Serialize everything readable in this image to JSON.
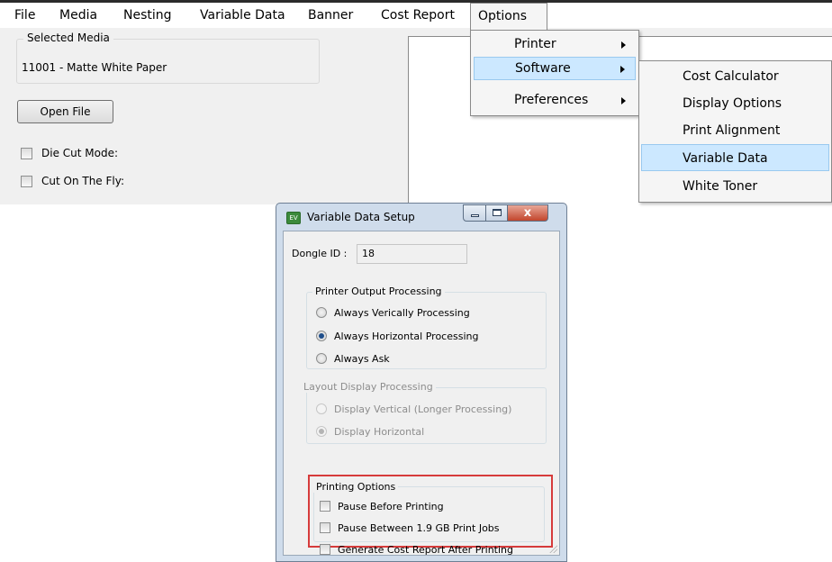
{
  "menubar": {
    "items": [
      "File",
      "Media",
      "Nesting",
      "Variable Data",
      "Banner",
      "Cost Report",
      "Options"
    ]
  },
  "main": {
    "selected_media_legend": "Selected Media",
    "selected_media_value": "11001 - Matte White Paper",
    "open_file_label": "Open File",
    "die_cut_label": "Die Cut Mode:",
    "cut_on_fly_label": "Cut On The Fly:"
  },
  "options_menu": {
    "items": [
      "Printer",
      "Software",
      "Preferences"
    ]
  },
  "software_submenu": {
    "items": [
      "Cost Calculator",
      "Display Options",
      "Print Alignment",
      "Variable Data",
      "White Toner"
    ]
  },
  "dialog": {
    "icon_text": "EV",
    "title": "Variable Data Setup",
    "close_glyph": "x",
    "dongle_label": "Dongle ID :",
    "dongle_value": "18",
    "printer_output": {
      "legend": "Printer Output Processing",
      "options": [
        "Always Verically Processing",
        "Always Horizontal Processing",
        "Always Ask"
      ],
      "selected": "Always Horizontal Processing"
    },
    "layout_display": {
      "legend": "Layout Display Processing",
      "options": [
        "Display Vertical (Longer Processing)",
        "Display Horizontal"
      ],
      "selected": "Display Horizontal"
    },
    "printing_options": {
      "legend": "Printing Options",
      "options": [
        "Pause Before Printing",
        "Pause Between 1.9 GB Print Jobs",
        "Generate Cost Report After Printing"
      ]
    }
  },
  "colors": {
    "menu_highlight": "#cce8ff",
    "dialog_frame": "#cfdceb",
    "callout_border": "#d63b3b"
  }
}
